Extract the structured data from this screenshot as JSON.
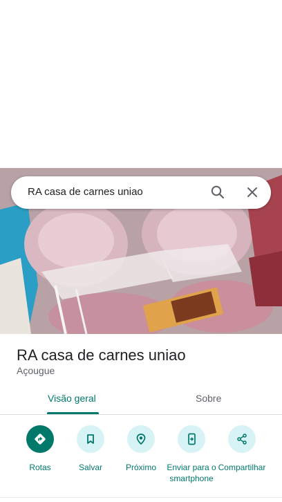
{
  "search": {
    "query": "RA casa de carnes uniao"
  },
  "place": {
    "name": "RA casa de carnes uniao",
    "category": "Açougue"
  },
  "tabs": [
    {
      "label": "Visão geral",
      "active": true
    },
    {
      "label": "Sobre",
      "active": false
    }
  ],
  "actions": [
    {
      "label": "Rotas",
      "icon": "directions-icon"
    },
    {
      "label": "Salvar",
      "icon": "bookmark-icon"
    },
    {
      "label": "Próximo",
      "icon": "nearby-icon"
    },
    {
      "label": "Enviar para o smartphone",
      "icon": "send-to-phone-icon"
    },
    {
      "label": "Compartilhar",
      "icon": "share-icon"
    }
  ],
  "colors": {
    "accent": "#00796b",
    "action_bg": "#d7f3f6",
    "text": "#202124",
    "secondary_text": "#5f6368"
  }
}
